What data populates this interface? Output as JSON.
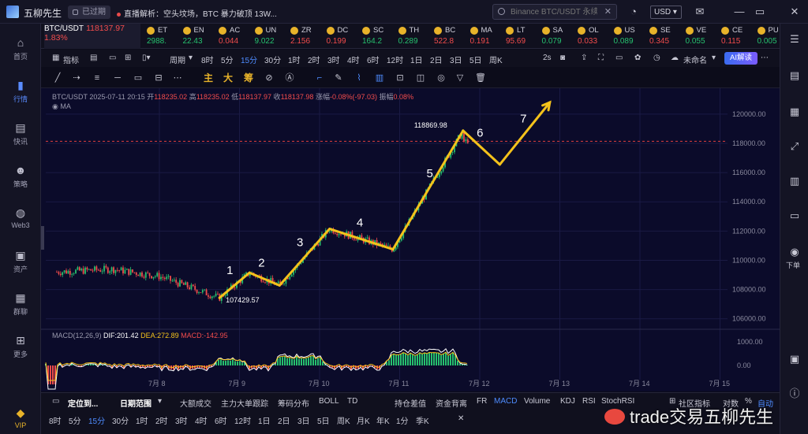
{
  "app": {
    "title": "五柳先生",
    "status": "已过期",
    "news": "直播解析：空头坟场，BTC 暴力破顶 13W...",
    "search_placeholder": "Binance BTC/USDT 永续",
    "currency": "USD"
  },
  "nav": [
    {
      "label": "首页",
      "icon": "home-icon"
    },
    {
      "label": "行情",
      "icon": "bar-chart-icon",
      "active": true
    },
    {
      "label": "快讯",
      "icon": "news-icon"
    },
    {
      "label": "策略",
      "icon": "robot-icon"
    },
    {
      "label": "Web3",
      "icon": "web3-icon"
    },
    {
      "label": "资产",
      "icon": "wallet-icon"
    },
    {
      "label": "群聊",
      "icon": "chat-icon"
    },
    {
      "label": "更多",
      "icon": "grid-icon"
    },
    {
      "label": "VIP",
      "icon": "diamond-icon"
    }
  ],
  "coins": {
    "active": {
      "name": "BTC/USDT",
      "price": "118137.97",
      "change": "1.83%"
    },
    "list": [
      {
        "name": "ET",
        "price": "2988.",
        "color": "#26c06e"
      },
      {
        "name": "EN",
        "price": "22.43",
        "color": "#26c06e"
      },
      {
        "name": "AC",
        "price": "0.044",
        "color": "#f24c4c"
      },
      {
        "name": "UN",
        "price": "9.022",
        "color": "#26c06e"
      },
      {
        "name": "ZR",
        "price": "2.156",
        "color": "#f24c4c"
      },
      {
        "name": "DC",
        "price": "0.199",
        "color": "#f24c4c"
      },
      {
        "name": "SC",
        "price": "164.2",
        "color": "#26c06e"
      },
      {
        "name": "TH",
        "price": "0.289",
        "color": "#26c06e"
      },
      {
        "name": "BC",
        "price": "522.8",
        "color": "#f24c4c"
      },
      {
        "name": "MA",
        "price": "0.191",
        "color": "#f24c4c"
      },
      {
        "name": "LT",
        "price": "95.69",
        "color": "#f24c4c"
      },
      {
        "name": "SA",
        "price": "0.079",
        "color": "#26c06e"
      },
      {
        "name": "OL",
        "price": "0.033",
        "color": "#f24c4c"
      },
      {
        "name": "US",
        "price": "0.089",
        "color": "#26c06e"
      },
      {
        "name": "SE",
        "price": "0.345",
        "color": "#f24c4c"
      },
      {
        "name": "VE",
        "price": "0.055",
        "color": "#26c06e"
      },
      {
        "name": "CE",
        "price": "0.115",
        "color": "#f24c4c"
      },
      {
        "name": "PU",
        "price": "0.005",
        "color": "#26c06e"
      }
    ]
  },
  "toolbar": {
    "indicator": "指标",
    "period": "周期",
    "intervals": [
      "8时",
      "5分",
      "15分",
      "30分",
      "1时",
      "2时",
      "3时",
      "4时",
      "6时",
      "12时",
      "1日",
      "2日",
      "3日",
      "5日",
      "周K"
    ],
    "active_interval": "15分",
    "refresh": "2s",
    "layout_name": "未命名",
    "ai": "AI解读"
  },
  "draw_tools": {
    "main": "主",
    "big": "大",
    "chips": "筹"
  },
  "chart_info": {
    "symbol": "BTC/USDT",
    "date": "2025-07-11 20:15",
    "open_label": "开",
    "open": "118235.02",
    "high_label": "高",
    "high": "118235.02",
    "low_label": "低",
    "low": "118137.97",
    "close_label": "收",
    "close": "118137.98",
    "change_label": "涨幅",
    "change": "-0.08%(-97.03)",
    "amp_label": "振幅",
    "amp": "0.08%",
    "ma_label": "MA",
    "macd_label": "MACD(12,26,9)",
    "dif": "DIF:201.42",
    "dea": "DEA:272.89",
    "macd": "MACD:-142.95"
  },
  "chart_data": {
    "type": "candlestick",
    "x_ticks": [
      "7月 8",
      "7月 9",
      "7月 10",
      "7月 11",
      "7月 12",
      "7月 13",
      "7月 14",
      "7月 15"
    ],
    "y_ticks": [
      "120000.00",
      "118000.00",
      "116000.00",
      "114000.00",
      "112000.00",
      "110000.00",
      "108000.00",
      "106000.00"
    ],
    "macd_ticks": [
      "1000.00",
      "0.00"
    ],
    "ylim": [
      105500,
      120800
    ],
    "price_line": 118140,
    "annotations": {
      "low": "107429.57",
      "high": "118869.98"
    },
    "waves": [
      {
        "label": "1",
        "x": "7月 8 18:00",
        "y": 107429
      },
      {
        "label": "2",
        "x": "7月 9 03:00",
        "y": 109150
      },
      {
        "label": "3",
        "x": "7月 9 12:00",
        "y": 108280
      },
      {
        "label": "4",
        "x": "7月 10 03:00",
        "y": 112150
      },
      {
        "label": "5",
        "x": "7月 10 22:00",
        "y": 110750
      },
      {
        "label": "6",
        "x": "7月 11 19:00",
        "y": 118869
      },
      {
        "label": "7",
        "x": "7月 12 06:00",
        "y": 116550
      },
      {
        "label": "",
        "x": "7月 12 21:00",
        "y": 120800
      }
    ],
    "wave_label_pos": [
      {
        "label": "1",
        "after": 0
      },
      {
        "label": "2",
        "after": 1
      },
      {
        "label": "3",
        "after": 2
      },
      {
        "label": "4",
        "after": 3
      },
      {
        "label": "5",
        "after": 4
      },
      {
        "label": "6",
        "after": 5
      },
      {
        "label": "7",
        "after": 6
      }
    ]
  },
  "bottom": {
    "locate": "定位到...",
    "date_range": "日期范围",
    "items": [
      "大额成交",
      "主力大单跟踪",
      "筹码分布",
      "BOLL",
      "TD",
      "持仓差值",
      "资金背离",
      "FR",
      "MACD",
      "Volume",
      "KDJ",
      "RSI",
      "StochRSI"
    ],
    "active_item": "MACD",
    "community": "社区指标",
    "log": "对数",
    "percent": "%",
    "auto": "自动",
    "intervals2": [
      "8时",
      "5分",
      "15分",
      "30分",
      "1时",
      "2时",
      "3时",
      "4时",
      "6时",
      "12时",
      "1日",
      "2日",
      "3日",
      "5日",
      "周K",
      "月K",
      "年K",
      "1分",
      "季K"
    ],
    "active_interval2": "15分"
  },
  "right_panel": {
    "down_label": "下单"
  },
  "watermark": "trade交易五柳先生",
  "colors": {
    "up": "#26c06e",
    "down": "#f24c4c",
    "accent": "#4e8cff",
    "wave": "#f4c21b"
  }
}
